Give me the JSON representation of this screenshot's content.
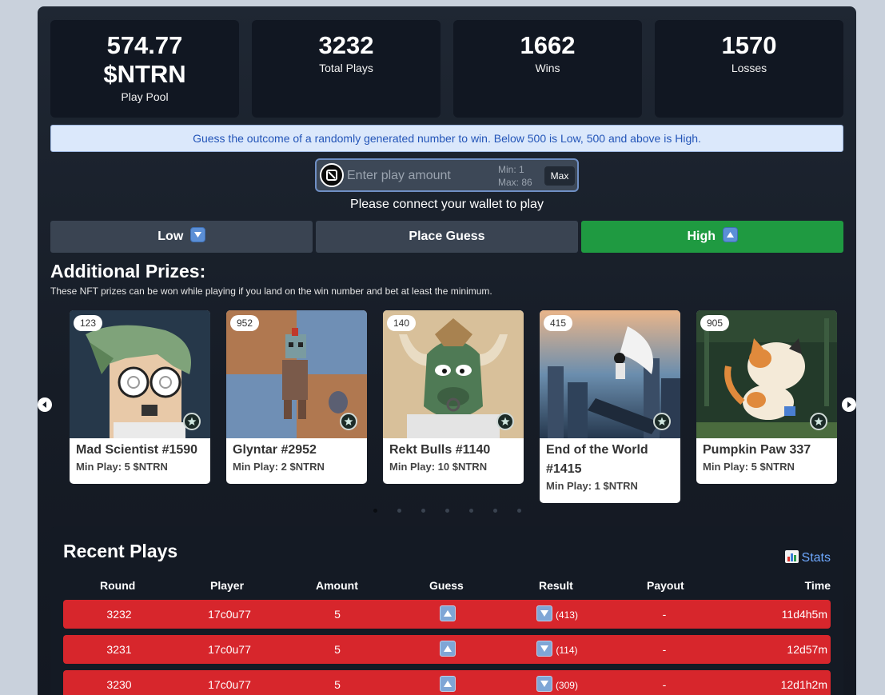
{
  "stats": [
    {
      "value_line1": "574.77",
      "value_line2": "$NTRN",
      "label": "Play Pool"
    },
    {
      "value": "3232",
      "label": "Total Plays"
    },
    {
      "value": "1662",
      "label": "Wins"
    },
    {
      "value": "1570",
      "label": "Losses"
    }
  ],
  "info_text": "Guess the outcome of a randomly generated number to win. Below 500 is Low, 500 and above is High.",
  "amount_input": {
    "placeholder": "Enter play amount",
    "min_label": "Min: 1",
    "max_label": "Max: 86",
    "max_button": "Max"
  },
  "connect_text": "Please connect your wallet to play",
  "buttons": {
    "low": "Low",
    "place": "Place Guess",
    "high": "High"
  },
  "prizes": {
    "title": "Additional Prizes:",
    "subtitle": "These NFT prizes can be won while playing if you land on the win number and bet at least the minimum.",
    "items": [
      {
        "number": "123",
        "name": "Mad Scientist #1590",
        "min_play": "Min Play: 5 $NTRN"
      },
      {
        "number": "952",
        "name": "Glyntar #2952",
        "min_play": "Min Play: 2 $NTRN"
      },
      {
        "number": "140",
        "name": "Rekt Bulls #1140",
        "min_play": "Min Play: 10 $NTRN"
      },
      {
        "number": "415",
        "name": "End of the World #1415",
        "min_play": "Min Play: 1 $NTRN"
      },
      {
        "number": "905",
        "name": "Pumpkin Paw 337",
        "min_play": "Min Play: 5 $NTRN"
      }
    ]
  },
  "recent": {
    "title": "Recent Plays",
    "stats_link": "Stats",
    "headers": [
      "Round",
      "Player",
      "Amount",
      "Guess",
      "Result",
      "Payout",
      "Time"
    ],
    "rows": [
      {
        "round": "3232",
        "player": "17c0u77",
        "amount": "5",
        "guess": "up",
        "result": "down",
        "result_num": "(413)",
        "payout": "-",
        "time": "11d4h5m"
      },
      {
        "round": "3231",
        "player": "17c0u77",
        "amount": "5",
        "guess": "up",
        "result": "down",
        "result_num": "(114)",
        "payout": "-",
        "time": "12d57m"
      },
      {
        "round": "3230",
        "player": "17c0u77",
        "amount": "5",
        "guess": "up",
        "result": "down",
        "result_num": "(309)",
        "payout": "-",
        "time": "12d1h2m"
      }
    ]
  },
  "colors": {
    "high": "#1f9a41",
    "row_loss": "#d7262c",
    "neutral_button": "#3a4452",
    "link": "#6ea8fe"
  }
}
